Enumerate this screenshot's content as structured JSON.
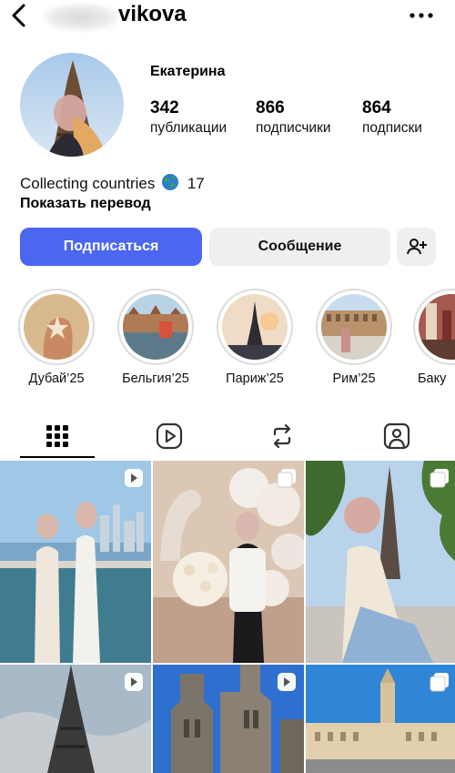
{
  "header": {
    "username": "enmavikova",
    "back_icon": "chevron-left-icon",
    "more_icon": "ellipsis-icon"
  },
  "profile": {
    "display_name": "Екатерина",
    "stats": [
      {
        "value": "342",
        "label": "публикации"
      },
      {
        "value": "866",
        "label": "подписчики"
      },
      {
        "value": "864",
        "label": "подписки"
      }
    ],
    "bio_text": "Collecting countries",
    "bio_count": "17",
    "translate_link": "Показать перевод"
  },
  "actions": {
    "follow": "Подписаться",
    "message": "Сообщение",
    "add_user_icon": "add-person-icon"
  },
  "highlights": [
    {
      "label": "Дубай’25"
    },
    {
      "label": "Бельгия’25"
    },
    {
      "label": "Париж’25"
    },
    {
      "label": "Рим’25"
    },
    {
      "label": "Баку"
    }
  ],
  "tabs": [
    {
      "icon": "grid-icon",
      "selected": true
    },
    {
      "icon": "reels-icon",
      "selected": false
    },
    {
      "icon": "repost-icon",
      "selected": false
    },
    {
      "icon": "tagged-icon",
      "selected": false
    }
  ],
  "colors": {
    "accent": "#4b66f1",
    "button_bg": "#efefef"
  }
}
